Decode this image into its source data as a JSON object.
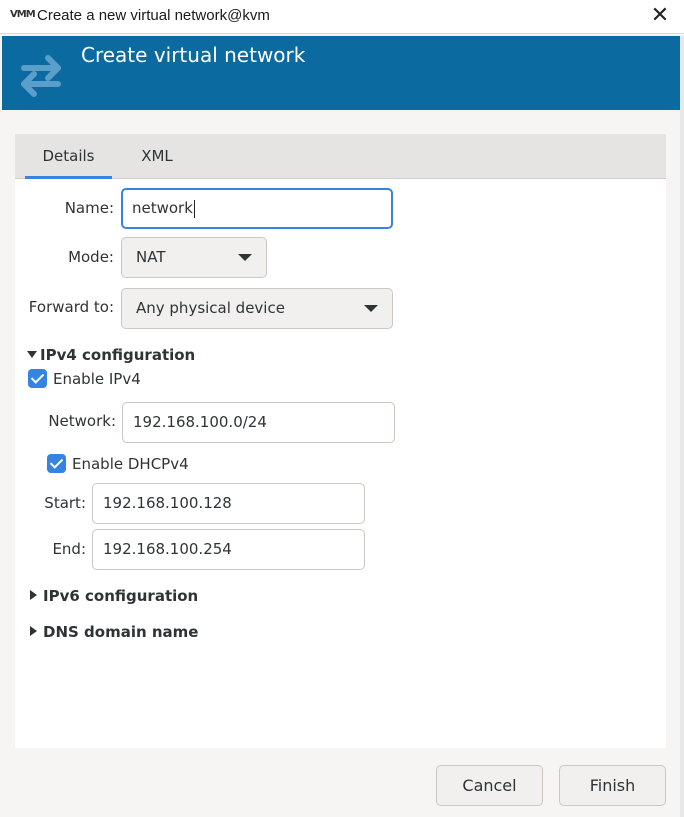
{
  "window": {
    "app_icon_text": "VMM",
    "title": "Create a new virtual network@kvm",
    "close_glyph": "✕"
  },
  "banner": {
    "heading": "Create virtual network",
    "icon": "network-arrows-icon",
    "color": "#0b6aa0"
  },
  "tabs": [
    {
      "label": "Details",
      "active": true
    },
    {
      "label": "XML",
      "active": false
    }
  ],
  "form": {
    "name": {
      "label": "Name:",
      "value": "network"
    },
    "mode": {
      "label": "Mode:",
      "value": "NAT"
    },
    "forward": {
      "label": "Forward to:",
      "value": "Any physical device"
    }
  },
  "ipv4": {
    "header": "IPv4 configuration",
    "expanded": true,
    "enable_label": "Enable IPv4",
    "enable_checked": true,
    "network_label": "Network:",
    "network_value": "192.168.100.0/24",
    "dhcp_label": "Enable DHCPv4",
    "dhcp_checked": true,
    "start_label": "Start:",
    "start_value": "192.168.100.128",
    "end_label": "End:",
    "end_value": "192.168.100.254"
  },
  "ipv6": {
    "header": "IPv6 configuration",
    "expanded": false
  },
  "dns": {
    "header": "DNS domain name",
    "expanded": false
  },
  "buttons": {
    "cancel": "Cancel",
    "finish": "Finish"
  },
  "colors": {
    "accent": "#3584e4",
    "banner": "#0b6aa0"
  }
}
